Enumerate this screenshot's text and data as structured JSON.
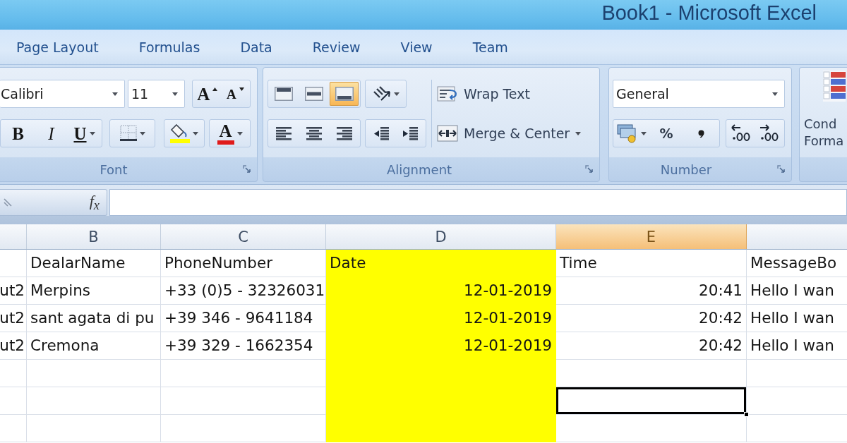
{
  "window": {
    "title": "Book1 - Microsoft Excel"
  },
  "ribbon_tabs": [
    {
      "label": "Page Layout",
      "selected": false
    },
    {
      "label": "Formulas",
      "selected": false
    },
    {
      "label": "Data",
      "selected": false
    },
    {
      "label": "Review",
      "selected": false
    },
    {
      "label": "View",
      "selected": false
    },
    {
      "label": "Team",
      "selected": false
    }
  ],
  "font_group": {
    "label": "Font",
    "font_name": "Calibri",
    "font_size": "11",
    "size_buttons": [
      {
        "kind": "grow",
        "label": "A"
      },
      {
        "kind": "shrink",
        "label": "A"
      }
    ],
    "style_buttons": [
      {
        "kind": "bold",
        "label": "B"
      },
      {
        "kind": "italic",
        "label": "I"
      },
      {
        "kind": "underline",
        "label": "U"
      }
    ],
    "font_color_button": {
      "label": "A"
    }
  },
  "alignment_group": {
    "label": "Alignment",
    "vertical_align": [
      {
        "kind": "top",
        "selected": false
      },
      {
        "kind": "middle",
        "selected": false
      },
      {
        "kind": "bottom",
        "selected": true
      }
    ],
    "horizontal_align": [
      {
        "kind": "left",
        "selected": false
      },
      {
        "kind": "center",
        "selected": false
      },
      {
        "kind": "right",
        "selected": false
      }
    ],
    "wrap_text": {
      "label": "Wrap Text"
    },
    "merge_center": {
      "label": "Merge & Center"
    }
  },
  "number_group": {
    "label": "Number",
    "format": "General",
    "percent_button": {
      "label": "%"
    }
  },
  "styles_group": {
    "conditional_formatting": {
      "label_lines": [
        "Cond",
        "Forma"
      ]
    }
  },
  "formula_bar": {
    "function_button": {
      "label": "f$_{x}$"
    }
  },
  "sheet": {
    "columns": [
      {
        "selected": false
      },
      {
        "label": "B",
        "selected": false
      },
      {
        "label": "C",
        "selected": false
      },
      {
        "label": "D",
        "selected": false,
        "color": "#ffff00"
      },
      {
        "label": "E",
        "selected": true
      },
      {
        "selected": false
      }
    ],
    "rows": [
      {
        "cells": [
          {
            "kind": "empty",
            "selected": false
          },
          {
            "kind": "text",
            "text": "DealarName",
            "selected": false
          },
          {
            "kind": "text",
            "text": "PhoneNumber",
            "selected": false
          },
          {
            "kind": "text",
            "text": "Date",
            "selected": false
          },
          {
            "kind": "text",
            "text": "Time",
            "selected": false
          },
          {
            "kind": "text",
            "text": "MessageBo",
            "selected": false
          }
        ]
      },
      {
        "cells": [
          {
            "kind": "cut",
            "text": "ut2",
            "selected": false
          },
          {
            "kind": "text",
            "text": "Merpins",
            "selected": false
          },
          {
            "kind": "text",
            "text": "+33 (0)5 - 32326031",
            "selected": false
          },
          {
            "kind": "number",
            "text": "12-01-2019",
            "selected": false
          },
          {
            "kind": "number",
            "text": "20:41",
            "selected": false
          },
          {
            "kind": "text",
            "text": "Hello I wan",
            "selected": false
          }
        ]
      },
      {
        "cells": [
          {
            "kind": "cut",
            "text": "ut2",
            "selected": false
          },
          {
            "kind": "text",
            "text": "sant agata di pu",
            "selected": false
          },
          {
            "kind": "text",
            "text": "+39 346 - 9641184",
            "selected": false
          },
          {
            "kind": "number",
            "text": "12-01-2019",
            "selected": false
          },
          {
            "kind": "number",
            "text": "20:42",
            "selected": false
          },
          {
            "kind": "text",
            "text": "Hello I wan",
            "selected": false
          }
        ]
      },
      {
        "cells": [
          {
            "kind": "cut",
            "text": "ut2",
            "selected": false
          },
          {
            "kind": "text",
            "text": "Cremona",
            "selected": false
          },
          {
            "kind": "text",
            "text": "+39 329 - 1662354",
            "selected": false
          },
          {
            "kind": "number",
            "text": "12-01-2019",
            "selected": false
          },
          {
            "kind": "number",
            "text": "20:42",
            "selected": false
          },
          {
            "kind": "text",
            "text": "Hello I wan",
            "selected": false
          }
        ]
      },
      {
        "cells": [
          {
            "kind": "empty",
            "selected": false
          },
          {
            "kind": "empty",
            "selected": false
          },
          {
            "kind": "empty",
            "selected": false
          },
          {
            "kind": "empty",
            "selected": false
          },
          {
            "kind": "empty",
            "selected": false
          },
          {
            "kind": "empty",
            "selected": false
          }
        ]
      },
      {
        "cells": [
          {
            "kind": "empty",
            "selected": false
          },
          {
            "kind": "empty",
            "selected": false
          },
          {
            "kind": "empty",
            "selected": false
          },
          {
            "kind": "empty",
            "selected": false
          },
          {
            "kind": "empty",
            "selected": true
          },
          {
            "kind": "empty",
            "selected": false
          }
        ]
      },
      {
        "cells": [
          {
            "kind": "empty",
            "selected": false
          },
          {
            "kind": "empty",
            "selected": false
          },
          {
            "kind": "empty",
            "selected": false
          },
          {
            "kind": "empty",
            "selected": false
          },
          {
            "kind": "empty",
            "selected": false
          },
          {
            "kind": "empty",
            "selected": false
          }
        ]
      }
    ]
  }
}
